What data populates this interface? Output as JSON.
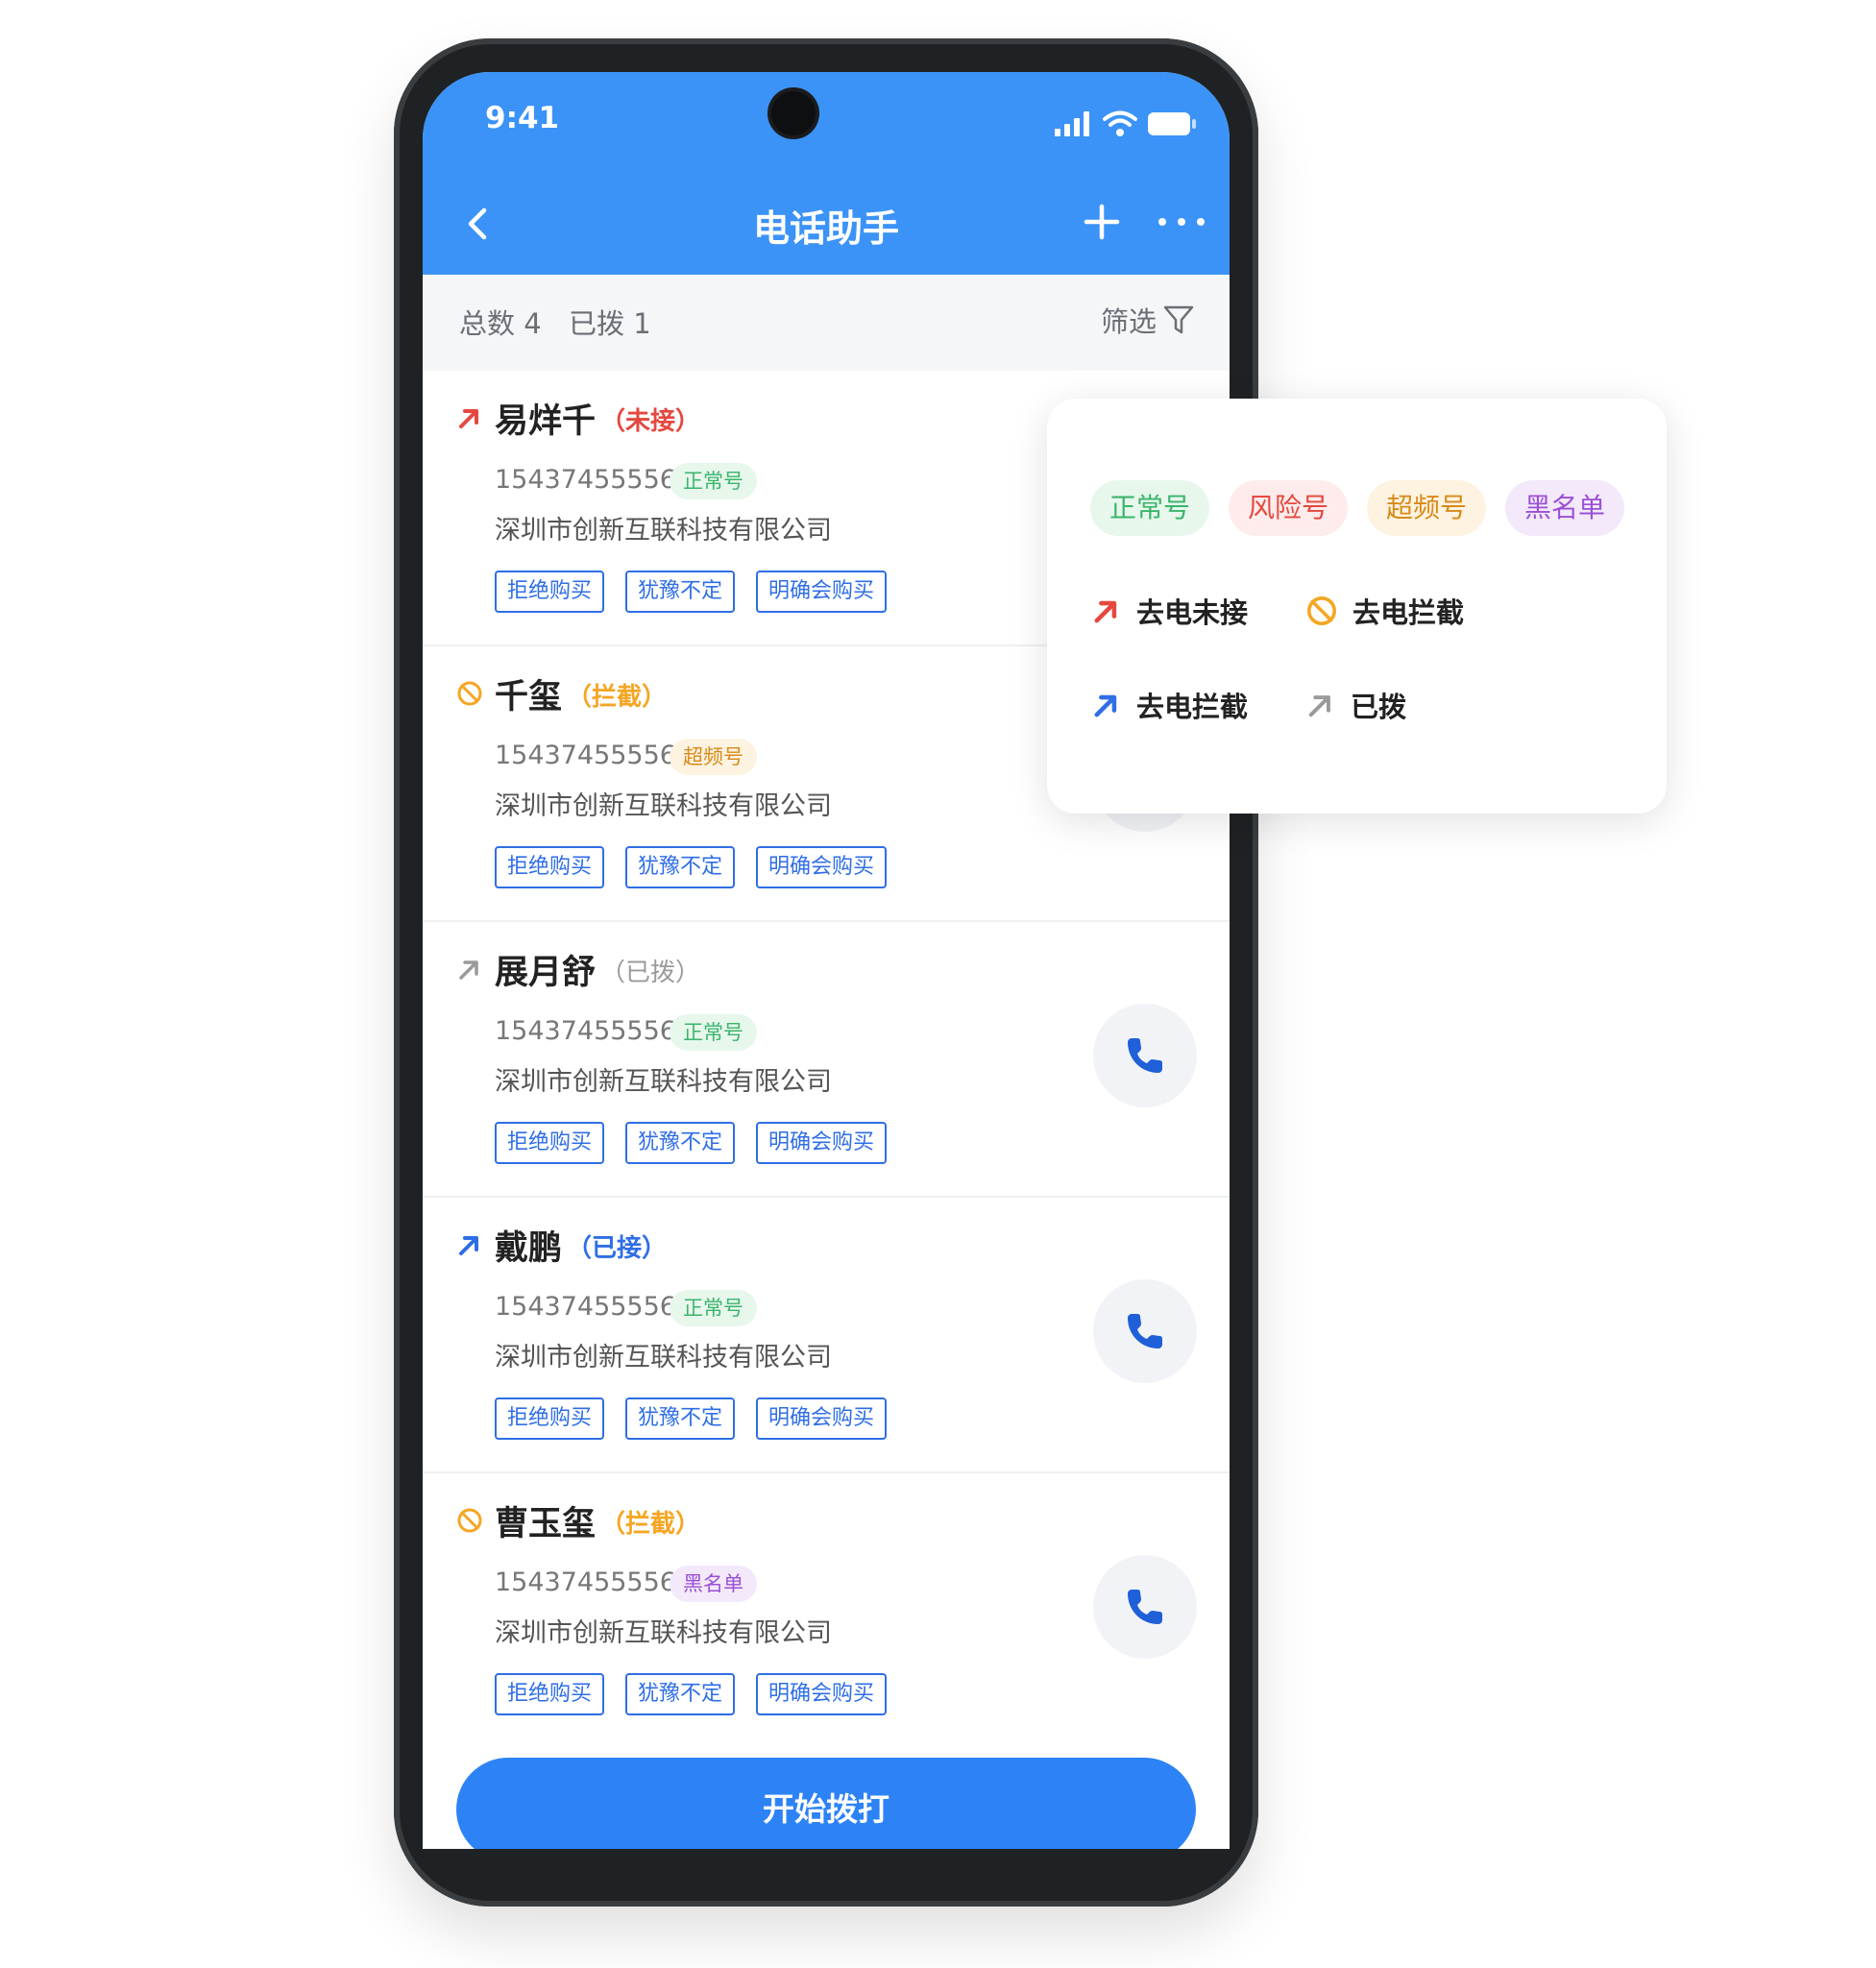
{
  "status_bar": {
    "time": "9:41"
  },
  "nav": {
    "title": "电话助手"
  },
  "summary": {
    "total": "总数 4",
    "dialed": "已拨 1",
    "filter_label": "筛选"
  },
  "colors": {
    "header": "#3b93f7",
    "missed": "#e5483f",
    "blocked": "#f5a623",
    "answered": "#2f6ee6",
    "dialed": "#9a9a9a"
  },
  "contacts": [
    {
      "name": "易烊千",
      "status": "（未接）",
      "status_type": "missed",
      "icon": "arrow-up-right-red-icon",
      "phone": "15437455556",
      "badge": "正常号",
      "badge_type": "normal",
      "company": "深圳市创新互联科技有限公司",
      "tags": [
        "拒绝购买",
        "犹豫不定",
        "明确会购买"
      ]
    },
    {
      "name": "千玺",
      "status": "（拦截）",
      "status_type": "blocked",
      "icon": "blocked-circle-icon",
      "phone": "15437455556",
      "badge": "超频号",
      "badge_type": "freq",
      "company": "深圳市创新互联科技有限公司",
      "tags": [
        "拒绝购买",
        "犹豫不定",
        "明确会购买"
      ]
    },
    {
      "name": "展月舒",
      "status": "（已拨）",
      "status_type": "dialed",
      "icon": "arrow-up-right-gray-icon",
      "phone": "15437455556",
      "badge": "正常号",
      "badge_type": "normal",
      "company": "深圳市创新互联科技有限公司",
      "tags": [
        "拒绝购买",
        "犹豫不定",
        "明确会购买"
      ]
    },
    {
      "name": "戴鹏",
      "status": "（已接）",
      "status_type": "answered",
      "icon": "arrow-up-right-blue-icon",
      "phone": "15437455556",
      "badge": "正常号",
      "badge_type": "normal",
      "company": "深圳市创新互联科技有限公司",
      "tags": [
        "拒绝购买",
        "犹豫不定",
        "明确会购买"
      ]
    },
    {
      "name": "曹玉玺",
      "status": "（拦截）",
      "status_type": "blocked",
      "icon": "blocked-circle-icon",
      "phone": "15437455556",
      "badge": "黑名单",
      "badge_type": "black",
      "company": "深圳市创新互联科技有限公司",
      "tags": [
        "拒绝购买",
        "犹豫不定",
        "明确会购买"
      ]
    }
  ],
  "start_button": {
    "label": "开始拨打"
  },
  "legend": {
    "badges": [
      "正常号",
      "风险号",
      "超频号",
      "黑名单"
    ],
    "missed": "去电未接",
    "blocked": "去电拦截",
    "answered": "去电拦截",
    "dialed": "已拨"
  }
}
